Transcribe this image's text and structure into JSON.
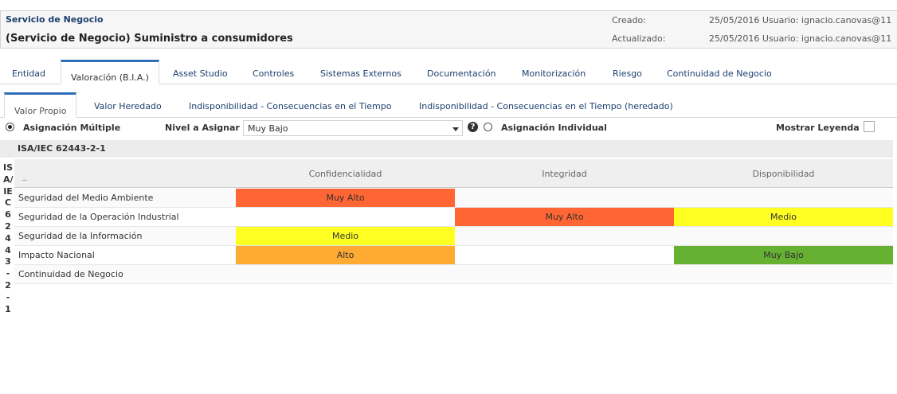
{
  "header": {
    "type_label": "Servicio de Negocio",
    "name": "(Servicio de Negocio) Suministro a consumidores",
    "created_label": "Creado:",
    "created_value": "25/05/2016  Usuario:  ignacio.canovas@11",
    "updated_label": "Actualizado:",
    "updated_value": "25/05/2016  Usuario:  ignacio.canovas@11"
  },
  "main_tabs": [
    {
      "label": "Entidad"
    },
    {
      "label": "Valoración (B.I.A.)",
      "active": true
    },
    {
      "label": "Asset Studio"
    },
    {
      "label": "Controles"
    },
    {
      "label": "Sistemas Externos"
    },
    {
      "label": "Documentación"
    },
    {
      "label": "Monitorización"
    },
    {
      "label": "Riesgo"
    },
    {
      "label": "Continuidad de Negocio"
    }
  ],
  "sub_tabs": [
    {
      "label": "Valor Propio",
      "active": true
    },
    {
      "label": "Valor Heredado"
    },
    {
      "label": "Indisponibilidad - Consecuencias en el Tiempo"
    },
    {
      "label": "Indisponibilidad - Consecuencias en el Tiempo (heredado)"
    }
  ],
  "toolbar": {
    "multi_label": "Asignación Múltiple",
    "level_label": "Nivel a Asignar",
    "level_value": "Muy Bajo",
    "individual_label": "Asignación Individual",
    "legend_label": "Mostrar Leyenda",
    "multi_checked": true,
    "individual_checked": false,
    "legend_checked": false
  },
  "section": {
    "title": "ISA/IEC 62443-2-1",
    "vertical_label": "ISA/IEC62443-2-1"
  },
  "grid": {
    "corner": "_",
    "columns": [
      "Confidencialidad",
      "Integridad",
      "Disponibilidad"
    ],
    "rows": [
      {
        "label": "Seguridad del Medio Ambiente",
        "cells": [
          "Muy Alto",
          "",
          ""
        ]
      },
      {
        "label": "Seguridad de la Operación Industrial",
        "cells": [
          "",
          "Muy Alto",
          "Medio"
        ]
      },
      {
        "label": "Seguridad de la Información",
        "cells": [
          "Medio",
          "",
          ""
        ]
      },
      {
        "label": "Impacto Nacional",
        "cells": [
          "Alto",
          "",
          "Muy Bajo"
        ]
      },
      {
        "label": "Continuidad de Negocio",
        "cells": [
          "",
          "",
          ""
        ]
      }
    ]
  },
  "level_colors": {
    "Muy Alto": "#ff6633",
    "Alto": "#ffaa33",
    "Medio": "#ffff22",
    "Bajo": "#99cc33",
    "Muy Bajo": "#66b032"
  }
}
